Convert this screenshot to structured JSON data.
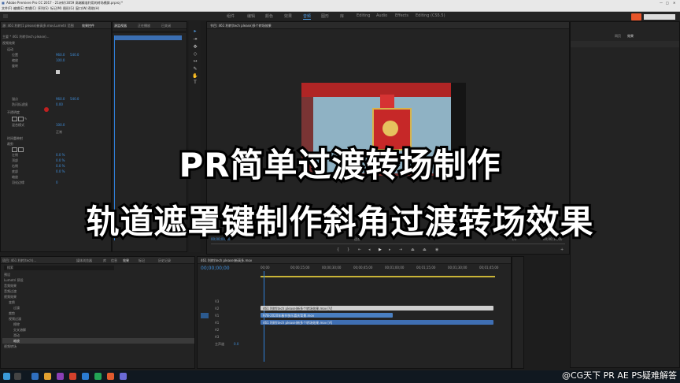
{
  "titlebar": {
    "title": "Adobe Premiere Pro CC 2017 - 21诗轩\\3059 高端精准利用的转场横屏.prproj *"
  },
  "menubar": {
    "items": [
      "文件(F)",
      "编辑(E)",
      "剪辑(C)",
      "序列(S)",
      "标记(M)",
      "图形(G)",
      "窗口(W)",
      "帮助(H)"
    ]
  },
  "workspaces": [
    "组件",
    "编辑",
    "颜色",
    "效果",
    "音频",
    "图形",
    "库",
    "Editing",
    "Audio",
    "Effects",
    "Editing (CS5.5)"
  ],
  "effect_controls": {
    "tabs": [
      "源: 461 利转(1 please)新高多.mov",
      "Lumetri 范围",
      "效果控件",
      "音频剪辑混合器"
    ],
    "clip_label": "主要 * 461 利转(tech please)...",
    "video_effects": "视频效果",
    "motion": "运动",
    "position_label": "位置",
    "position_values": [
      "960.0",
      "540.0"
    ],
    "scale_label": "缩放",
    "scale_value": "100.0",
    "rotation_label": "旋转",
    "opacity_label": "不透明度",
    "anchor_label": "锚点",
    "anchor_values": [
      "960.0",
      "540.0"
    ],
    "antiflicker_label": "防闪烁滤镜",
    "antiflicker_value": "0.00",
    "track_matte_label": "轨道遮罩键",
    "mask_label": "蒙版",
    "blend_label": "混合模式",
    "blend_value": "正常",
    "time_remap": "时间重映射",
    "crop_label": "裁剪",
    "crop_rows": [
      "左侧",
      "顶部",
      "右侧",
      "底部"
    ],
    "crop_values": [
      "0.0 %",
      "0.0 %",
      "0.0 %",
      "0.0 %"
    ],
    "zoom_label": "缩放",
    "edge_label": "羽化边缘",
    "edge_value": "0"
  },
  "mini_timeline": {
    "tabs": [
      "源监视器",
      "正在播放",
      "已关闭"
    ],
    "timecodes": [
      "00:00",
      "00:00:15",
      "00:00:30"
    ]
  },
  "program_monitor": {
    "tab": "节目: 461 利转(tech please)多个转场效果",
    "timecode_left": "00;00;00;00",
    "fit": "适合",
    "quality": "1/2",
    "timecode_right": "00;00;10;00"
  },
  "right_panel": {
    "tabs": [
      "网页",
      "效果"
    ]
  },
  "project": {
    "tabs": [
      "项目: 461 利转(tech)...",
      "媒体浏览器",
      "库",
      "信息",
      "效果",
      "标记",
      "历史记录"
    ],
    "search_placeholder": "搜索",
    "items": [
      "预设",
      "Lumetri 预设",
      "音频效果",
      "音频过渡",
      "视频效果",
      "变换",
      "过渡",
      "裁剪",
      "视频过渡",
      "擦除",
      "交叉溶解",
      "滑动",
      "缩放",
      "视频转场",
      "轨道遮罩"
    ]
  },
  "timeline": {
    "tab": "461 利转(tech please)新高多.mov",
    "timecode": "00;00;00;00",
    "ruler": [
      "00;00",
      "00;00;15;00",
      "00;00;30;00",
      "00;00;45;00",
      "00;01;00;00",
      "00;01;15;00",
      "00;01;30;00",
      "00;01;45;00"
    ],
    "tracks": [
      "V3",
      "V2",
      "V1",
      "A1",
      "A2",
      "A3",
      "主声道"
    ],
    "clips": [
      {
        "name": "461 利转(tech please)新多个转场效果.mov [V]",
        "color": "#c8c8c8"
      },
      {
        "name": "978-2020年春节快乐喜庆背景.mov",
        "color": "#4a7fc1"
      },
      {
        "name": "461 利转(tech please)新多个转场效果.mov [A]",
        "color": "#3f6fb3"
      }
    ],
    "master_value": "0.0"
  },
  "banner": {
    "line1": "PR简单过渡转场制作",
    "line2": "轨道遮罩键制作斜角过渡转场效果"
  },
  "watermark": "@CG天下 PR AE PS疑难解答",
  "colors": {
    "accent_blue": "#3f8fdc",
    "playhead": "#2f7fd8",
    "red_bg": "#c52a2a"
  }
}
